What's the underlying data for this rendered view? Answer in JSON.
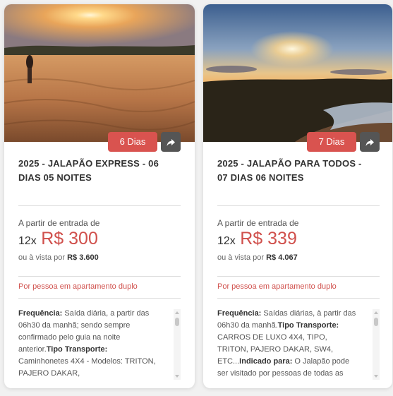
{
  "cards": [
    {
      "days": "6 Dias",
      "share_icon": "share-arrow-icon",
      "title": "2025 - JALAPÃO EXPRESS - 06 DIAS 05 NOITES",
      "from_label": "A partir de entrada de",
      "installments_count": "12x",
      "installment_price": "R$ 300",
      "cash_prefix": "ou à vista por",
      "cash_price": "R$ 3.600",
      "per_person": "Por pessoa em apartamento duplo",
      "desc": [
        {
          "b": "Frequência:",
          "t": " Saída diária, a partir das 06h30 da manhã; sendo sempre confirmado pelo guia na noite anterior."
        },
        {
          "b": "Tipo Transporte:",
          "t": " Caminhonetes 4X4 - Modelos: TRITON, PAJERO DAKAR,"
        }
      ]
    },
    {
      "days": "7 Dias",
      "share_icon": "share-arrow-icon",
      "title": "2025 - JALAPÃO PARA TODOS - 07 DIAS 06 NOITES",
      "from_label": "A partir de entrada de",
      "installments_count": "12x",
      "installment_price": "R$ 339",
      "cash_prefix": "ou à vista por",
      "cash_price": "R$ 4.067",
      "per_person": "Por pessoa em apartamento duplo",
      "desc": [
        {
          "b": "Frequência:",
          "t": " Saídas diárias, à partir das 06h30 da manhã."
        },
        {
          "b": "Tipo Transporte:",
          "t": " CARROS DE LUXO 4X4, TIPO, TRITON, PAJERO DAKAR, SW4, ETC..."
        },
        {
          "b": "Indicado para:",
          "t": " O Jalapão pode ser visitado por pessoas de todas as"
        }
      ]
    }
  ],
  "colors": {
    "accent": "#d0504c",
    "badge": "#d9534f",
    "share": "#555555"
  }
}
